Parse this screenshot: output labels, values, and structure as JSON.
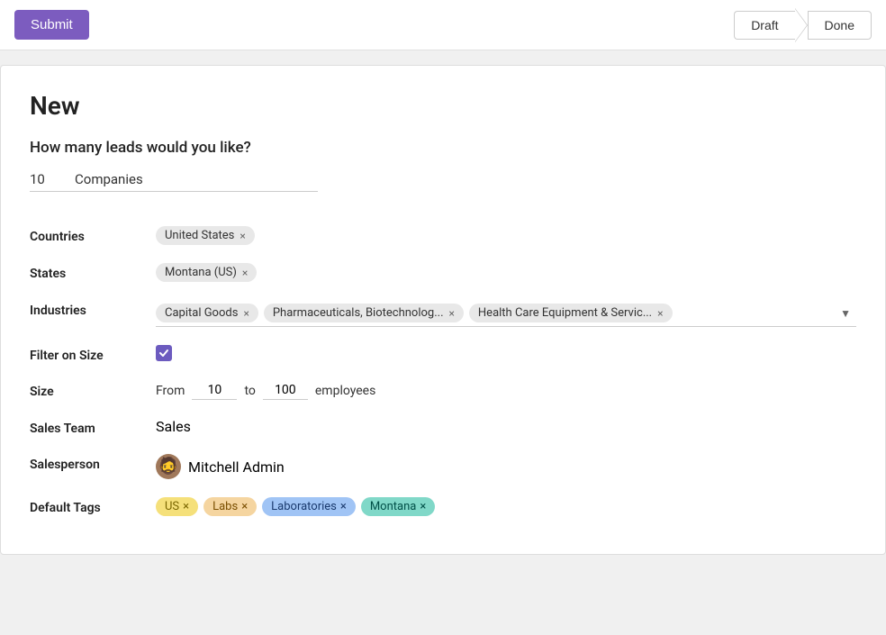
{
  "topbar": {
    "submit_label": "Submit",
    "draft_label": "Draft",
    "done_label": "Done"
  },
  "page": {
    "title": "New",
    "question": "How many leads would you like?",
    "leads_count": "10",
    "leads_type": "Companies"
  },
  "form": {
    "countries_label": "Countries",
    "countries": [
      {
        "text": "United States",
        "id": "us"
      }
    ],
    "states_label": "States",
    "states": [
      {
        "text": "Montana (US)",
        "id": "mt"
      }
    ],
    "industries_label": "Industries",
    "industries": [
      {
        "text": "Capital Goods",
        "id": "cg"
      },
      {
        "text": "Pharmaceuticals, Biotechnolog...",
        "id": "ph"
      },
      {
        "text": "Health Care Equipment & Servic...",
        "id": "hc"
      }
    ],
    "filter_on_size_label": "Filter on Size",
    "size_label": "Size",
    "size_from_label": "From",
    "size_from_value": "10",
    "size_to_label": "to",
    "size_to_value": "100",
    "size_unit": "employees",
    "sales_team_label": "Sales Team",
    "sales_team_value": "Sales",
    "salesperson_label": "Salesperson",
    "salesperson_name": "Mitchell Admin",
    "salesperson_avatar": "🧔",
    "default_tags_label": "Default Tags",
    "tags": [
      {
        "text": "US",
        "type": "us"
      },
      {
        "text": "Labs",
        "type": "labs"
      },
      {
        "text": "Laboratories",
        "type": "laboratories"
      },
      {
        "text": "Montana",
        "type": "montana"
      }
    ]
  }
}
